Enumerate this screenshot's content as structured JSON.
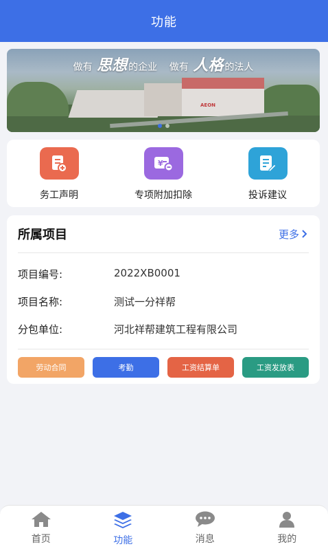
{
  "header": {
    "title": "功能"
  },
  "banner": {
    "slogan_parts": [
      "做有",
      "思想",
      "的企业",
      "做有",
      "人格",
      "的法人"
    ],
    "sign_text": "AEON",
    "active_slide": 1,
    "slide_count": 2
  },
  "functions": [
    {
      "label": "务工声明",
      "icon": "document-icon",
      "color": "#ea6a4f"
    },
    {
      "label": "专项附加扣除",
      "icon": "yuan-card-icon",
      "color": "#9b69e0"
    },
    {
      "label": "投诉建议",
      "icon": "edit-document-icon",
      "color": "#2ea3d8"
    }
  ],
  "project": {
    "title": "所属项目",
    "more_label": "更多",
    "fields": [
      {
        "key": "项目编号:",
        "value": "2022XB0001"
      },
      {
        "key": "项目名称:",
        "value": "测试一分祥帮"
      },
      {
        "key": "分包单位:",
        "value": "河北祥帮建筑工程有限公司"
      }
    ],
    "buttons": [
      {
        "label": "劳动合同",
        "color": "#f2a566"
      },
      {
        "label": "考勤",
        "color": "#3d6fe6"
      },
      {
        "label": "工资结算单",
        "color": "#e46445"
      },
      {
        "label": "工资发放表",
        "color": "#2a9b83"
      }
    ]
  },
  "tabbar": {
    "items": [
      {
        "label": "首页",
        "icon": "home-icon"
      },
      {
        "label": "功能",
        "icon": "layers-icon"
      },
      {
        "label": "消息",
        "icon": "chat-icon"
      },
      {
        "label": "我的",
        "icon": "user-icon"
      }
    ],
    "active_index": 1
  },
  "colors": {
    "primary": "#3d6fe6",
    "background": "#f2f3f7"
  }
}
